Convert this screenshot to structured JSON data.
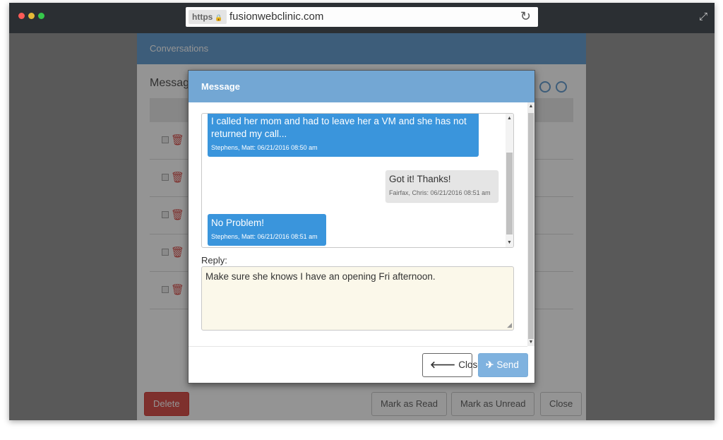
{
  "browser": {
    "https_label": "https",
    "lock_glyph": "🔒",
    "url": "fusionwebclinic.com",
    "reload_glyph": "↻",
    "expand_glyph": "⤢"
  },
  "background": {
    "panel_title": "Conversations",
    "subtitle": "Messag",
    "trash_glyph": "🗑",
    "buttons": {
      "delete": "Delete",
      "mark_read": "Mark as Read",
      "mark_unread": "Mark as Unread",
      "close": "Close"
    }
  },
  "modal": {
    "title": "Message",
    "messages": [
      {
        "text": "I called her mom and had to leave her a VM and she has not returned my call...",
        "meta": "Stephens, Matt: 06/21/2016 08:50 am"
      },
      {
        "text": "Got it! Thanks!",
        "meta": "Fairfax, Chris: 06/21/2016 08:51 am"
      },
      {
        "text": "No Problem!",
        "meta": "Stephens, Matt: 06/21/2016 08:51 am"
      }
    ],
    "reply_label": "Reply:",
    "reply_value": "Make sure she knows I have an opening Fri afternoon.",
    "close_button": {
      "icon": "🡐",
      "label": "Close"
    },
    "send_button": {
      "icon": "✈",
      "label": "Send"
    }
  },
  "colors": {
    "header_blue": "#73a7d4",
    "bubble_blue": "#3a95dc",
    "reply_bg": "#fbf8ea"
  }
}
